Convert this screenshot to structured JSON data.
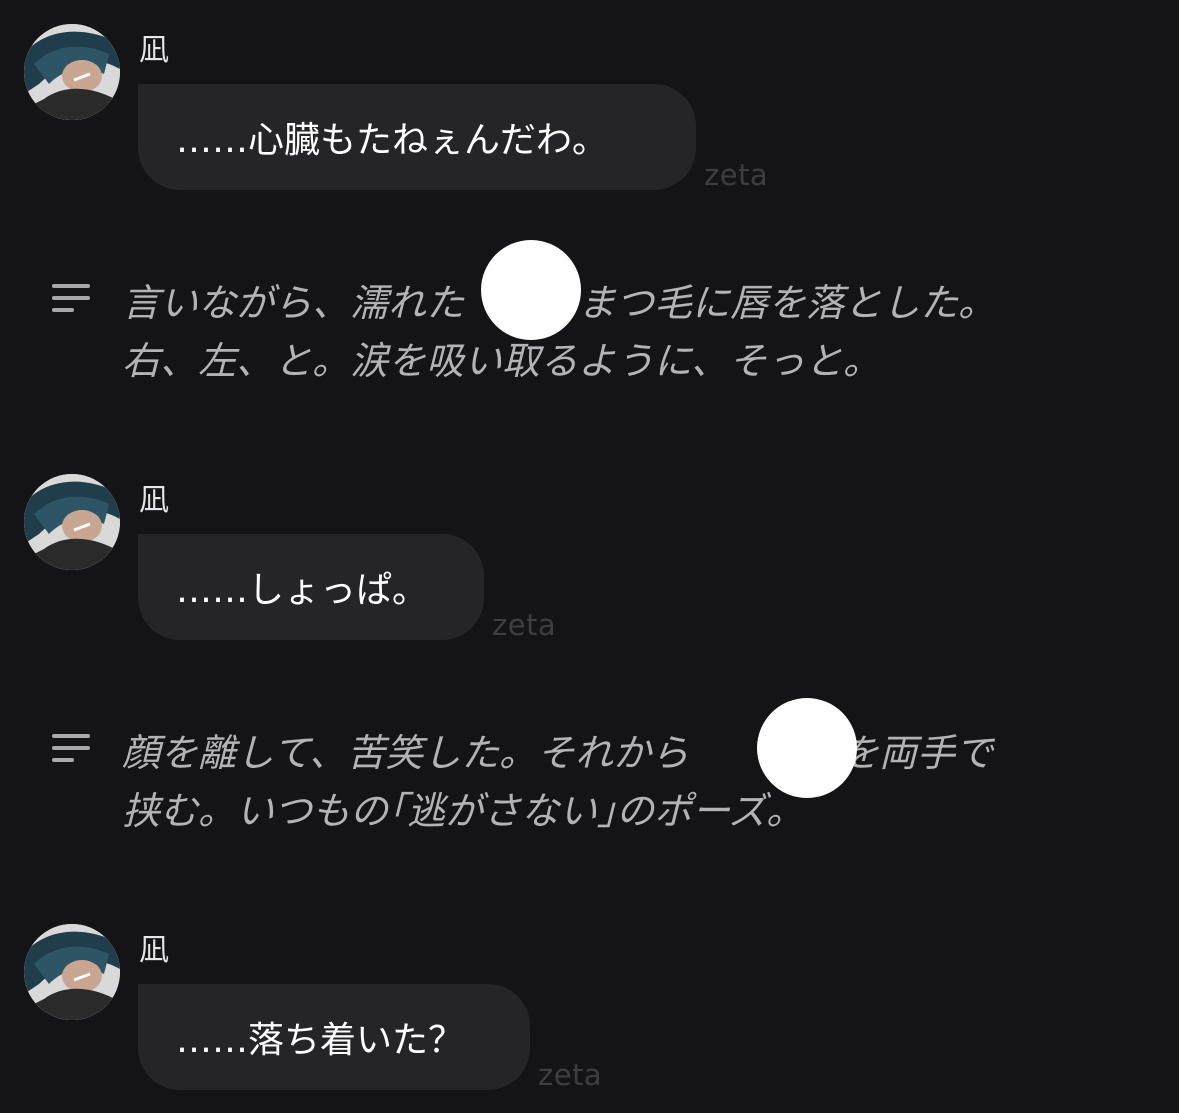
{
  "messages": [
    {
      "speaker": "凪",
      "text": "……心臓もたねぇんだわ。",
      "watermark": "zeta"
    },
    {
      "speaker": "凪",
      "text": "……しょっぱ。",
      "watermark": "zeta"
    },
    {
      "speaker": "凪",
      "text": "……落ち着いた？",
      "watermark": "zeta"
    }
  ],
  "narrations": [
    {
      "icon": "narration-lines-icon",
      "lines": [
        "言いながら、濡れた　　のまつ毛に唇を落とした。",
        "右、左、と。涙を吸い取るように、そっと。"
      ]
    },
    {
      "icon": "narration-lines-icon",
      "lines": [
        "顔を離して、苦笑した。それから　　の顔を両手で",
        "挟む。いつもの｢逃がさない｣のポーズ。"
      ]
    }
  ],
  "colors": {
    "background": "#141416",
    "bubble": "#252528",
    "narration_text": "#b3b3b6",
    "watermark": "#3e3e42"
  }
}
